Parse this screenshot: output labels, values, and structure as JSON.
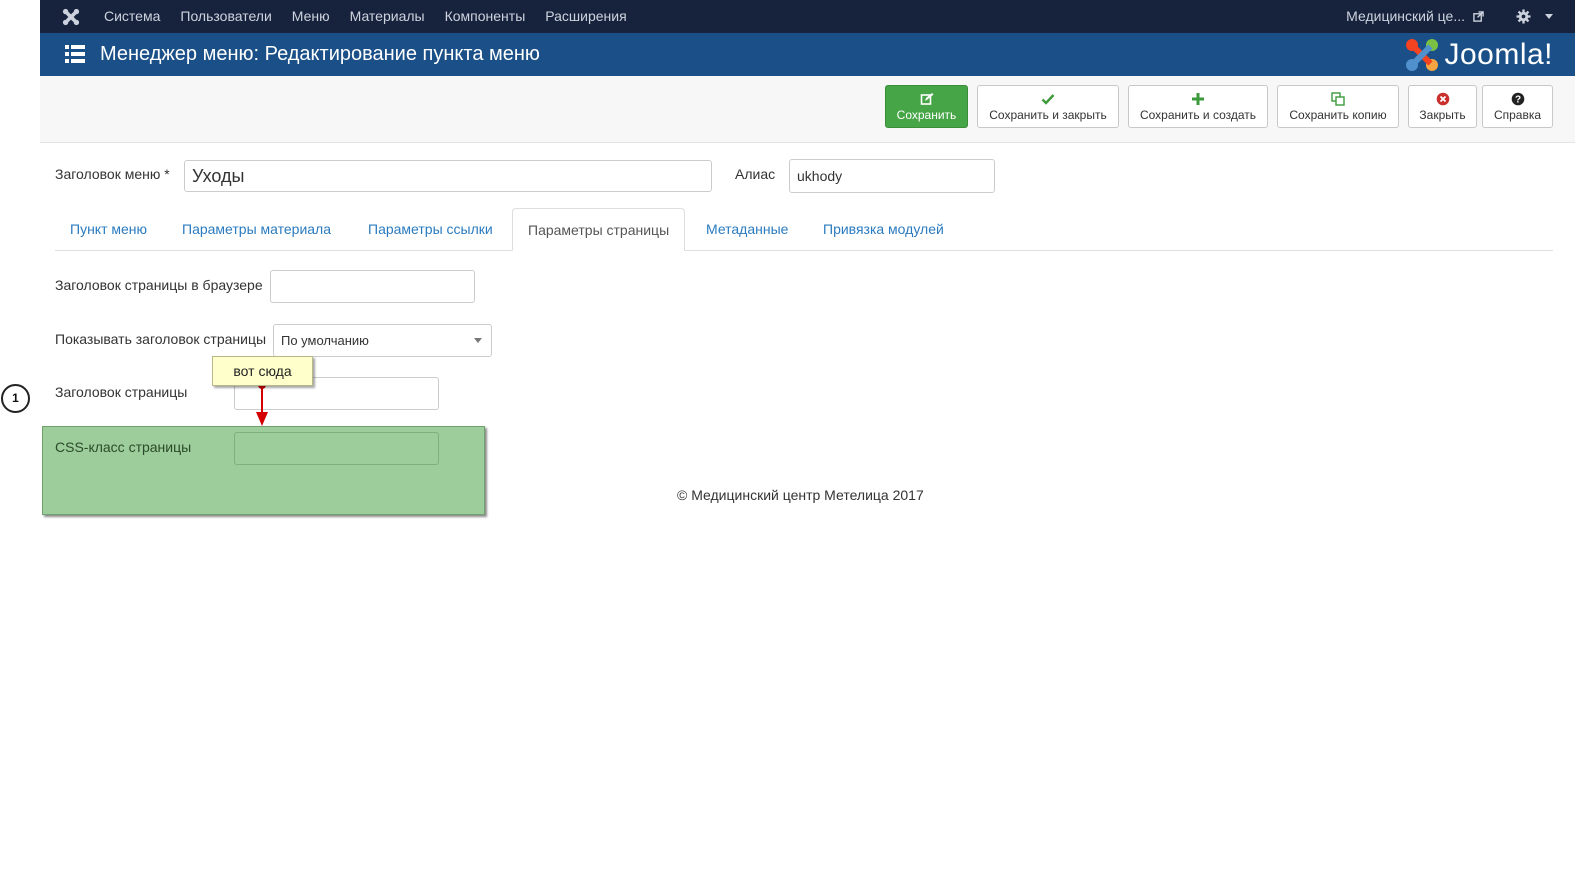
{
  "topnav": {
    "menu": [
      "Система",
      "Пользователи",
      "Меню",
      "Материалы",
      "Компоненты",
      "Расширения"
    ],
    "site_name": "Медицинский це..."
  },
  "header": {
    "title": "Менеджер меню: Редактирование пункта меню",
    "brand": "Joomla!"
  },
  "toolbar": {
    "save": "Сохранить",
    "save_close": "Сохранить и закрыть",
    "save_new": "Сохранить и создать",
    "save_copy": "Сохранить копию",
    "close": "Закрыть",
    "help": "Справка"
  },
  "form": {
    "title_label": "Заголовок меню *",
    "title_value": "Уходы",
    "alias_label": "Алиас",
    "alias_value": "ukhody"
  },
  "tabs": [
    "Пункт меню",
    "Параметры материала",
    "Параметры ссылки",
    "Параметры страницы",
    "Метаданные",
    "Привязка модулей"
  ],
  "active_tab": "Параметры страницы",
  "page_params": {
    "browser_title_label": "Заголовок страницы в браузере",
    "browser_title_value": "",
    "show_heading_label": "Показывать заголовок страницы",
    "show_heading_value": "По умолчанию",
    "page_heading_label": "Заголовок страницы",
    "page_heading_value": "",
    "css_class_label": "CSS-класс страницы",
    "css_class_value": ""
  },
  "annotation": {
    "callout": "вот сюда",
    "step": "1"
  },
  "footer": "© Медицинский центр Метелица 2017",
  "colors": {
    "topnav": "#17233d",
    "titlebar": "#1a4f87",
    "primary_button": "#46a546",
    "link": "#2a7bbf",
    "highlight": "#9ccd9a",
    "arrow": "#d40000"
  }
}
